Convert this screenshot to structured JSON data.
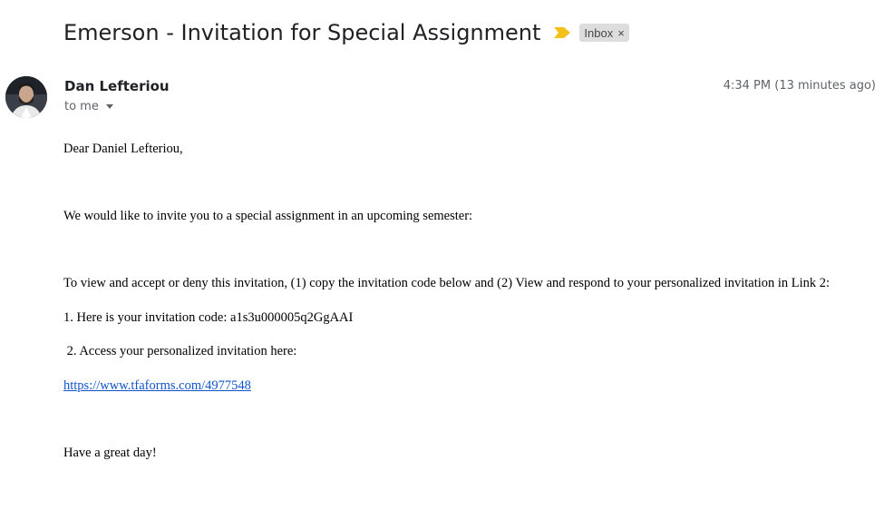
{
  "email": {
    "subject": "Emerson - Invitation for Special Assignment",
    "label": "Inbox",
    "label_remove": "×",
    "sender_name": "Dan Lefteriou",
    "recipient_summary": "to me",
    "timestamp": "4:34 PM (13 minutes ago)",
    "importance_color": "#f2c21b"
  },
  "body": {
    "greeting": "Dear Daniel Lefteriou,",
    "intro": "We would like to invite you to a special assignment in an upcoming semester:",
    "instructions": "To view and accept or deny this invitation, (1) copy the invitation code below and (2) View and respond to your personalized invitation in Link 2:",
    "step1": "1. Here is your invitation code: a1s3u000005q2GgAAI",
    "step2": " 2. Access your personalized invitation here:",
    "link": "https://www.tfaforms.com/4977548",
    "closing": "Have a great day!"
  }
}
